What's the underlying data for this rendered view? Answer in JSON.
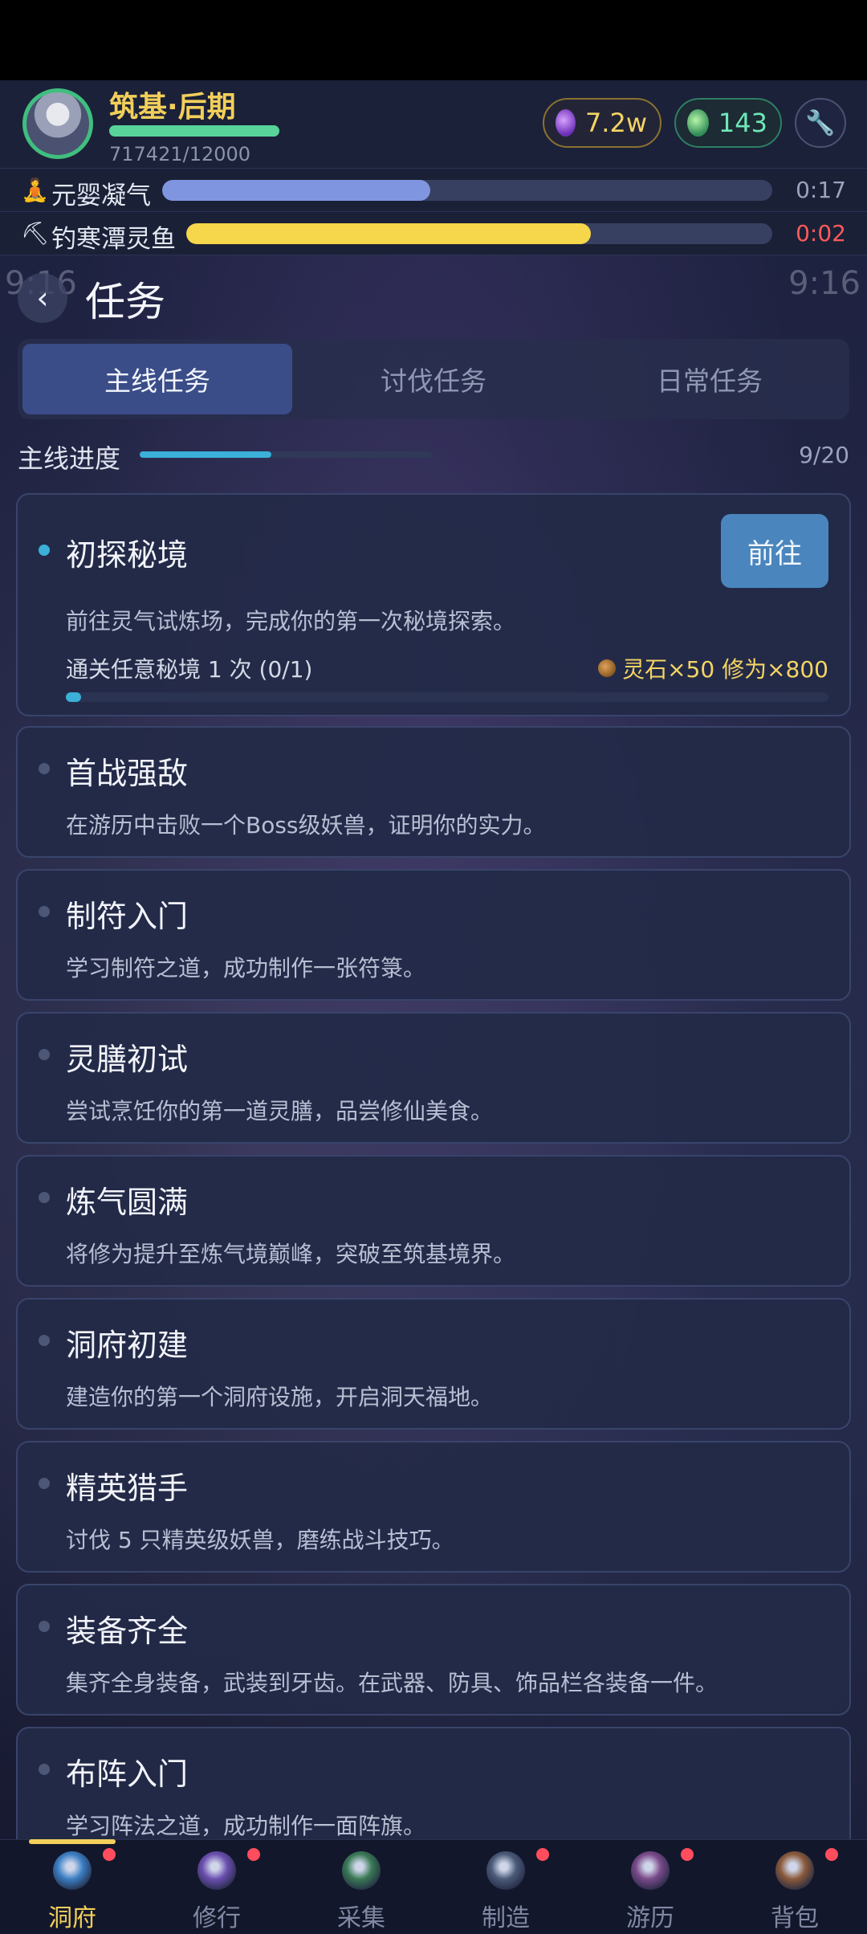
{
  "header": {
    "realm": "筑基·后期",
    "exp": "717421/12000",
    "stones": "7.2w",
    "jade": "143",
    "icons": {
      "stones": "spirit-stone-icon",
      "jade": "jade-icon",
      "settings": "wrench-icon"
    }
  },
  "activities": [
    {
      "label": "元婴凝气",
      "time": "0:17",
      "progress": 0.44,
      "color": "#7f95e0",
      "time_color": "#9aa3bd",
      "icon": "meditation-icon"
    },
    {
      "label": "钓寒潭灵鱼",
      "time": "0:02",
      "progress": 0.69,
      "color": "#f6d64a",
      "time_color": "#ff5a5a",
      "icon": "pickaxe-icon"
    }
  ],
  "status_ghost": {
    "left": "9:16",
    "right": "9:16"
  },
  "page": {
    "title": "任务",
    "back_icon": "chevron-left-icon"
  },
  "tabs": [
    "主线任务",
    "讨伐任务",
    "日常任务"
  ],
  "progress": {
    "label": "主线进度",
    "count": "9/20",
    "value": 0.45
  },
  "active_task": {
    "title": "初探秘境",
    "desc": "前往灵气试炼场，完成你的第一次秘境探索。",
    "button": "前往",
    "condition": "通关任意秘境 1 次 (0/1)",
    "reward": "灵石×50  修为×800",
    "progress": 0.02
  },
  "tasks": [
    {
      "title": "首战强敌",
      "desc": "在游历中击败一个Boss级妖兽，证明你的实力。"
    },
    {
      "title": "制符入门",
      "desc": "学习制符之道，成功制作一张符箓。"
    },
    {
      "title": "灵膳初试",
      "desc": "尝试烹饪你的第一道灵膳，品尝修仙美食。"
    },
    {
      "title": "炼气圆满",
      "desc": "将修为提升至炼气境巅峰，突破至筑基境界。"
    },
    {
      "title": "洞府初建",
      "desc": "建造你的第一个洞府设施，开启洞天福地。"
    },
    {
      "title": "精英猎手",
      "desc": "讨伐 5 只精英级妖兽，磨练战斗技巧。"
    },
    {
      "title": "装备齐全",
      "desc": "集齐全身装备，武装到牙齿。在武器、防具、饰品栏各装备一件。"
    },
    {
      "title": "布阵入门",
      "desc": "学习阵法之道，成功制作一面阵旗。"
    }
  ],
  "nav": [
    {
      "label": "洞府",
      "icon": "cave-icon",
      "color": "#3b7fc4",
      "badge": true,
      "active": true
    },
    {
      "label": "修行",
      "icon": "lotus-icon",
      "color": "#6b4fb0",
      "badge": true,
      "active": false
    },
    {
      "label": "采集",
      "icon": "herb-icon",
      "color": "#3a7a55",
      "badge": false,
      "active": false
    },
    {
      "label": "制造",
      "icon": "hammer-icon",
      "color": "#4a5a78",
      "badge": true,
      "active": false
    },
    {
      "label": "游历",
      "icon": "compass-icon",
      "color": "#7a4a8a",
      "badge": true,
      "active": false
    },
    {
      "label": "背包",
      "icon": "bag-icon",
      "color": "#8a5a3a",
      "badge": true,
      "active": false
    }
  ]
}
